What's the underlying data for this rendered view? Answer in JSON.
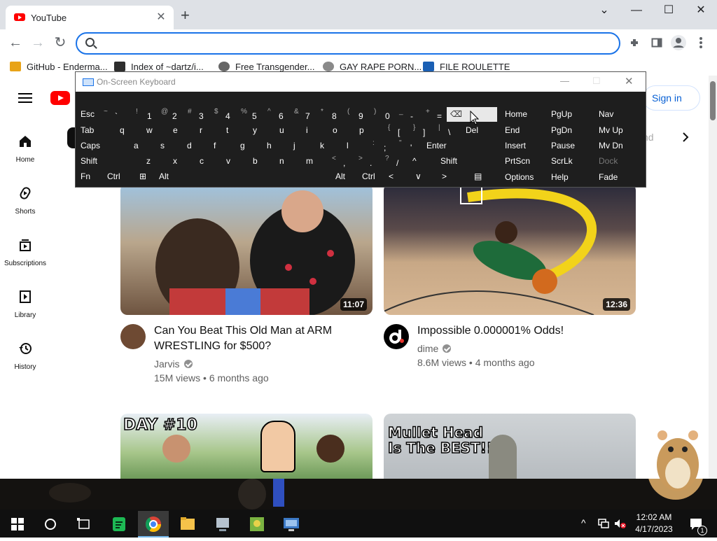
{
  "browser": {
    "tab_title": "YouTube",
    "tab_close": "✕",
    "new_tab": "+",
    "window_controls": {
      "dropdown": "⌄",
      "minimize": "—",
      "maximize": "☐",
      "close": "✕"
    },
    "nav": {
      "back": "←",
      "forward": "→",
      "reload": "↻"
    },
    "omnibox": {
      "value": "",
      "placeholder": ""
    },
    "bookmarks": [
      {
        "label": "GitHub - Enderma...",
        "icon": "ph-icon",
        "color": "#e8a317"
      },
      {
        "label": "Index of ~dartz/i...",
        "icon": "file-icon",
        "color": "#2e2e2e"
      },
      {
        "label": "Free Transgender...",
        "icon": "owl-icon",
        "color": "#666666"
      },
      {
        "label": "GAY RAPE PORN...",
        "icon": "globe-icon",
        "color": "#8a8a8a"
      },
      {
        "label": "FILE ROULETTE",
        "icon": "mft-icon",
        "color": "#1a5fb4"
      }
    ]
  },
  "youtube": {
    "sign_in": "Sign in",
    "sidebar": [
      {
        "label": "Home",
        "icon": "home-icon"
      },
      {
        "label": "Shorts",
        "icon": "shorts-icon"
      },
      {
        "label": "Subscriptions",
        "icon": "subscriptions-icon"
      },
      {
        "label": "Library",
        "icon": "library-icon"
      },
      {
        "label": "History",
        "icon": "history-icon"
      }
    ],
    "chip_partial": "nd",
    "videos": [
      {
        "title_line1": "Can You Beat This Old Man at ARM",
        "title_line2": "WRESTLING for $500?",
        "channel": "Jarvis",
        "views": "15M views",
        "age": "6 months ago",
        "duration": "11:07"
      },
      {
        "title_line1": "Impossible 0.000001% Odds!",
        "title_line2": "",
        "channel": "dime",
        "views": "8.6M views",
        "age": "4 months ago",
        "duration": "12:36"
      }
    ],
    "thumb_texts": {
      "day": "DAY #10",
      "mullet_line1": "Mullet Head",
      "mullet_line2": "Is The BEST!!"
    },
    "meta_sep": " • "
  },
  "osk": {
    "title": "On-Screen Keyboard",
    "title_controls": {
      "minimize": "—",
      "maximize": "☐",
      "close": "✕"
    },
    "row1": [
      {
        "main": "Esc"
      },
      {
        "top": "~",
        "main": "`"
      },
      {
        "top": "!",
        "main": "1"
      },
      {
        "top": "@",
        "main": "2"
      },
      {
        "top": "#",
        "main": "3"
      },
      {
        "top": "$",
        "main": "4"
      },
      {
        "top": "%",
        "main": "5"
      },
      {
        "top": "^",
        "main": "6"
      },
      {
        "top": "&",
        "main": "7"
      },
      {
        "top": "*",
        "main": "8"
      },
      {
        "top": "(",
        "main": "9"
      },
      {
        "top": ")",
        "main": "0"
      },
      {
        "top": "_",
        "main": "-"
      },
      {
        "top": "+",
        "main": "="
      },
      {
        "main": "⌫"
      }
    ],
    "row2": [
      {
        "main": "Tab"
      },
      {
        "main": "q"
      },
      {
        "main": "w"
      },
      {
        "main": "e"
      },
      {
        "main": "r"
      },
      {
        "main": "t"
      },
      {
        "main": "y"
      },
      {
        "main": "u"
      },
      {
        "main": "i"
      },
      {
        "main": "o"
      },
      {
        "main": "p"
      },
      {
        "top": "{",
        "main": "["
      },
      {
        "top": "}",
        "main": "]"
      },
      {
        "top": "|",
        "main": "\\"
      },
      {
        "main": "Del"
      }
    ],
    "row3": [
      {
        "main": "Caps"
      },
      {
        "main": "a"
      },
      {
        "main": "s"
      },
      {
        "main": "d"
      },
      {
        "main": "f"
      },
      {
        "main": "g"
      },
      {
        "main": "h"
      },
      {
        "main": "j"
      },
      {
        "main": "k"
      },
      {
        "main": "l"
      },
      {
        "top": ":",
        "main": ";"
      },
      {
        "top": "\"",
        "main": "'"
      },
      {
        "main": "Enter"
      }
    ],
    "row4": [
      {
        "main": "Shift"
      },
      {
        "main": "z"
      },
      {
        "main": "x"
      },
      {
        "main": "c"
      },
      {
        "main": "v"
      },
      {
        "main": "b"
      },
      {
        "main": "n"
      },
      {
        "main": "m"
      },
      {
        "top": "<",
        "main": ","
      },
      {
        "top": ">",
        "main": "."
      },
      {
        "top": "?",
        "main": "/"
      },
      {
        "main": "^"
      },
      {
        "main": "Shift"
      }
    ],
    "row5": [
      {
        "main": "Fn"
      },
      {
        "main": "Ctrl"
      },
      {
        "main": "⊞"
      },
      {
        "main": "Alt"
      },
      {
        "main": "Alt"
      },
      {
        "main": "Ctrl"
      },
      {
        "main": "<"
      },
      {
        "main": "∨"
      },
      {
        "main": ">"
      },
      {
        "main": "▤"
      }
    ],
    "nav_keys": [
      [
        "Home",
        "PgUp",
        "Nav"
      ],
      [
        "End",
        "PgDn",
        "Mv Up"
      ],
      [
        "Insert",
        "Pause",
        "Mv Dn"
      ],
      [
        "PrtScn",
        "ScrLk",
        "Dock"
      ],
      [
        "Options",
        "Help",
        "Fade"
      ]
    ]
  },
  "taskbar": {
    "time": "12:02 AM",
    "date": "4/17/2023",
    "notification_count": "1",
    "tray_chevron": "^"
  }
}
